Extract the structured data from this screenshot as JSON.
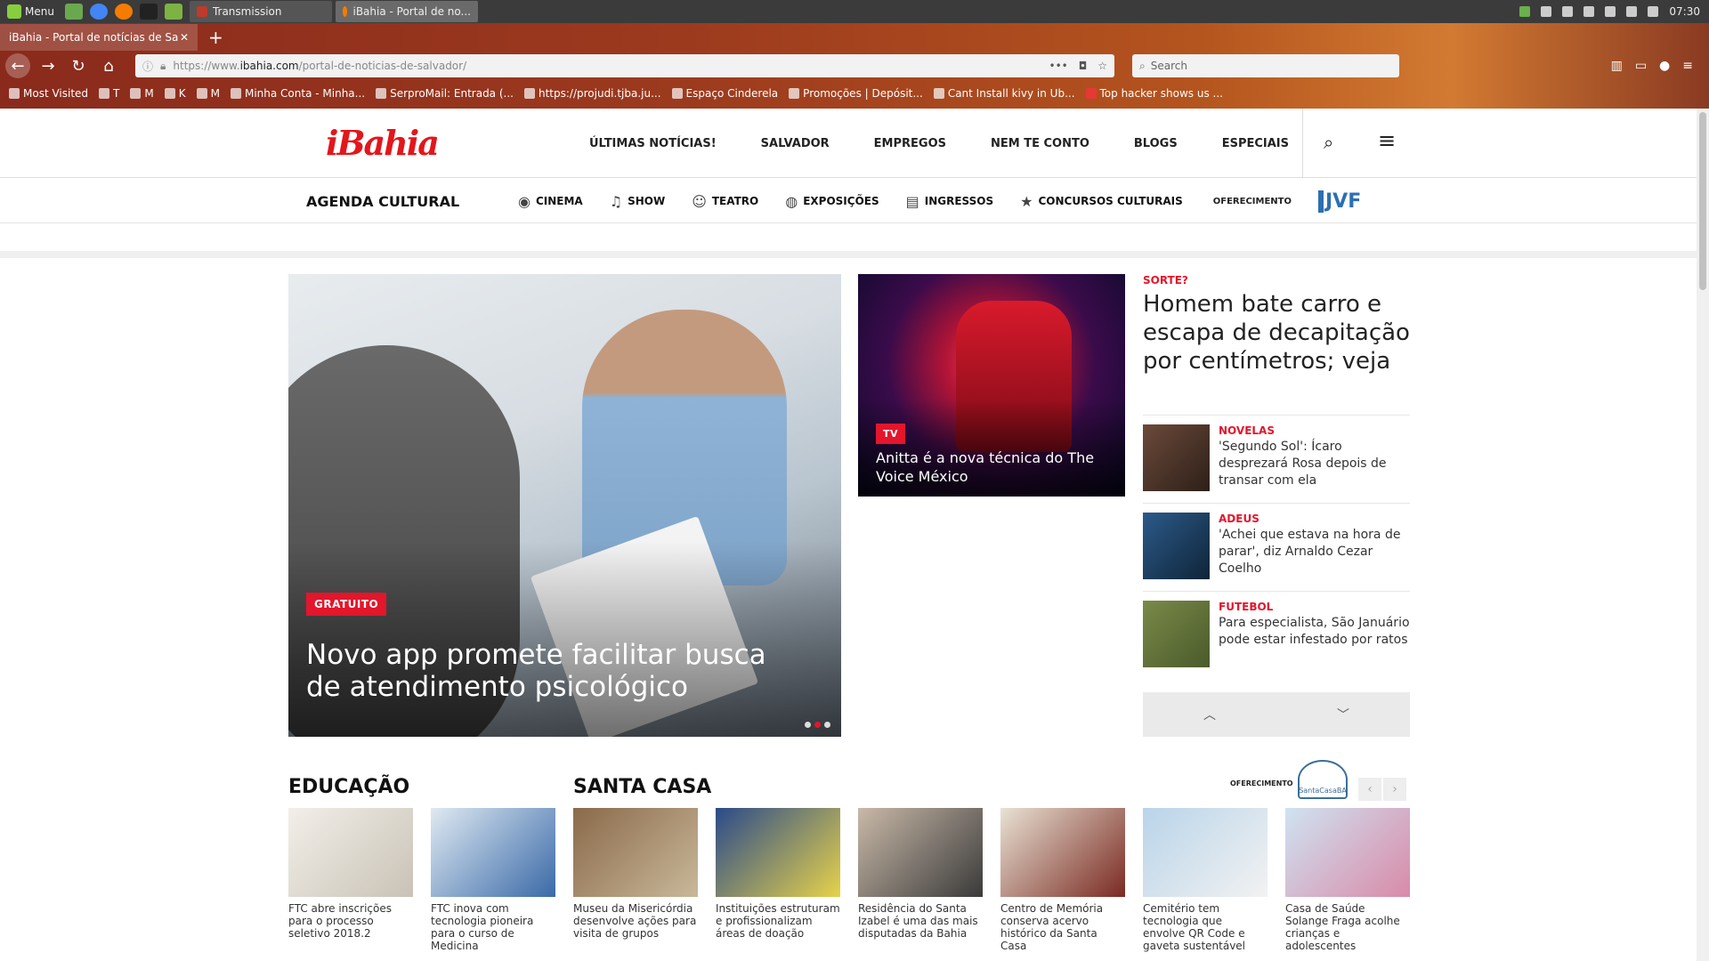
{
  "taskbar": {
    "menu_label": "Menu",
    "windows": [
      "Transmission",
      "iBahia - Portal de no..."
    ],
    "clock": "07:30"
  },
  "browser": {
    "tab_title": "iBahia - Portal de notícias de Salvador",
    "url_prefix": "https://www.",
    "url_domain": "ibahia.com",
    "url_path": "/portal-de-noticias-de-salvador/",
    "search_placeholder": "Search",
    "bookmarks": [
      "Most Visited",
      "T",
      "M",
      "K",
      "M",
      "Minha Conta - Minha...",
      "SerproMail: Entrada (...",
      "https://projudi.tjba.ju...",
      "Espaço Cinderela",
      "Promoções | Depósit...",
      "Cant Install kivy in Ub...",
      "Top hacker shows us ..."
    ]
  },
  "site": {
    "logo": "iBahia",
    "nav": [
      "ÚLTIMAS NOTÍCIAS!",
      "SALVADOR",
      "EMPREGOS",
      "NEM TE CONTO",
      "BLOGS",
      "ESPECIAIS"
    ],
    "agenda_title": "AGENDA CULTURAL",
    "agenda_items": [
      "CINEMA",
      "SHOW",
      "TEATRO",
      "EXPOSIÇÕES",
      "INGRESSOS",
      "CONCURSOS CULTURAIS"
    ],
    "oferecimento": "OFERECIMENTO",
    "sponsor_logo": "JVF"
  },
  "hero": {
    "tag": "GRATUITO",
    "title": "Novo app promete facilitar busca de atendimento psicológico"
  },
  "tv_story": {
    "tag": "TV",
    "title": "Anitta é a nova técnica do The Voice México"
  },
  "side": {
    "kicker": "SORTE?",
    "headline": "Homem bate carro e escapa de decapitação por centímetros; veja",
    "items": [
      {
        "kicker": "NOVELAS",
        "text": "'Segundo Sol': Ícaro desprezará Rosa depois de transar com ela"
      },
      {
        "kicker": "ADEUS",
        "text": "'Achei que estava na hora de parar', diz Arnaldo Cezar Coelho"
      },
      {
        "kicker": "FUTEBOL",
        "text": "Para especialista, São Januário pode estar infestado por ratos"
      }
    ]
  },
  "sections": {
    "educacao": "EDUCAÇÃO",
    "santa_casa": "SANTA CASA",
    "oferecimento": "OFERECIMENTO",
    "santa_casa_logo": "SantaCasaBA"
  },
  "cards": [
    "FTC abre inscrições para o processo seletivo 2018.2",
    "FTC inova com tecnologia pioneira para o curso de Medicina",
    "Museu da Misericórdia desenvolve ações para visita de grupos",
    "Instituições estruturam e profissionalizam áreas de doação",
    "Residência do Santa Izabel é uma das mais disputadas da Bahia",
    "Centro de Memória conserva acervo histórico da Santa Casa",
    "Cemitério tem tecnologia que envolve QR Code e gaveta sustentável",
    "Casa de Saúde Solange Fraga acolhe crianças e adolescentes"
  ]
}
